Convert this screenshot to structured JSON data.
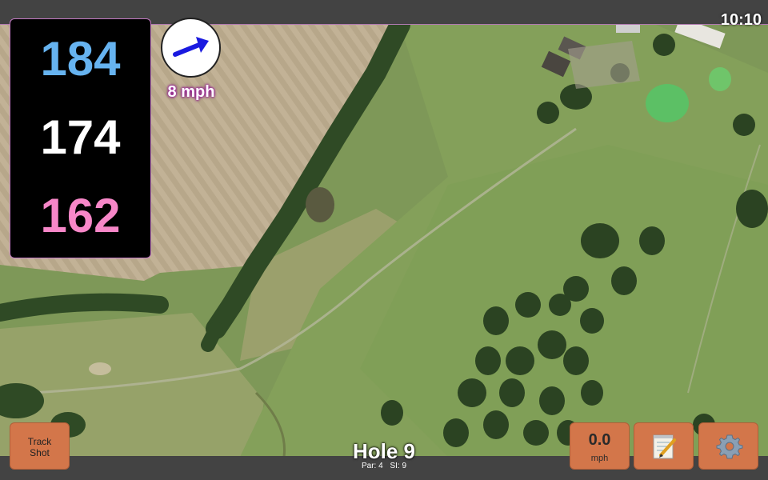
{
  "status": {
    "clock": "10:10"
  },
  "distances": {
    "back": "184",
    "middle": "174",
    "front": "162"
  },
  "wind": {
    "speed": "8 mph",
    "direction_icon": "arrow-icon"
  },
  "buttons": {
    "track_shot": "Track\nShot",
    "track_shot_line1": "Track",
    "track_shot_line2": "Shot",
    "speed_value": "0.0",
    "speed_unit": "mph",
    "notes_icon": "notepad-icon",
    "settings_icon": "gear-icon"
  },
  "hole": {
    "title": "Hole 9",
    "par": "Par: 4",
    "si": "SI: 9"
  },
  "colors": {
    "back": "#66b3f0",
    "middle": "#ffffff",
    "front": "#f787c8",
    "button": "#d3764a",
    "panel_border": "#c47ac4"
  }
}
